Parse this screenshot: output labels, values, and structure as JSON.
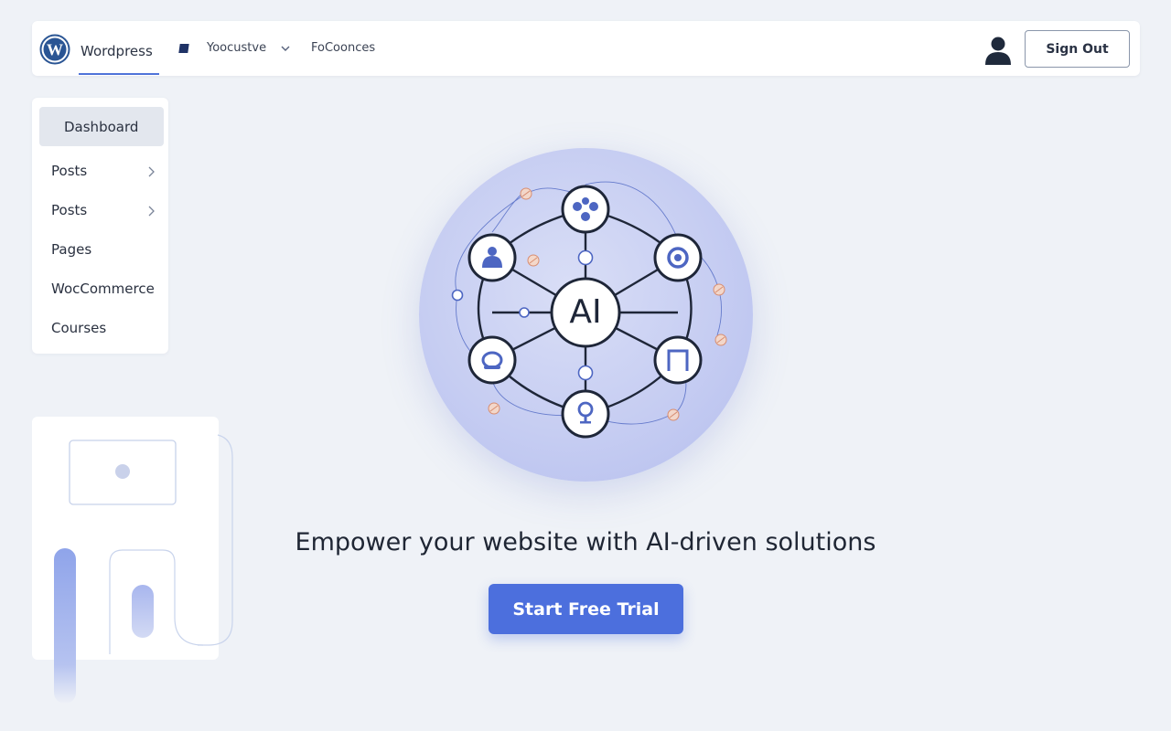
{
  "header": {
    "brand_label": "Wordpress",
    "nav": [
      {
        "label": "Yoocustve",
        "icon": "square-icon"
      },
      {
        "label": "FoCoonces"
      }
    ],
    "sign_out_label": "Sign Out"
  },
  "sidebar": {
    "items": [
      {
        "label": "Dashboard",
        "active": true
      },
      {
        "label": "Posts",
        "has_submenu": true
      },
      {
        "label": "Posts",
        "has_submenu": true
      },
      {
        "label": "Pages"
      },
      {
        "label": "WocCommerce"
      },
      {
        "label": "Courses"
      }
    ]
  },
  "hero": {
    "center_label": "AI",
    "headline": "Empower your website with AI-driven solutions",
    "cta_label": "Start Free Trial"
  },
  "colors": {
    "accent": "#4c6fdd",
    "background": "#eff2f7",
    "navy": "#1f3266"
  }
}
